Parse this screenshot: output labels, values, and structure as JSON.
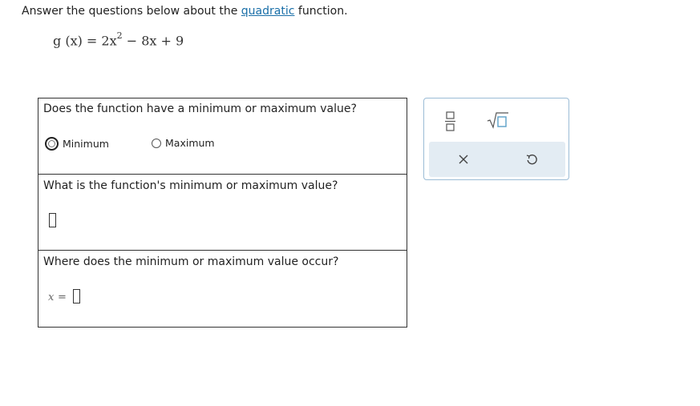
{
  "instructions": {
    "prefix": "Answer the questions below about the",
    "link_text": "quadratic",
    "suffix": "function."
  },
  "equation": {
    "lhs": "g (x) = 2x",
    "exponent": "2",
    "rhs": " − 8x + 9"
  },
  "questions": {
    "q1": {
      "text": "Does the function have a minimum or maximum value?",
      "options": [
        "Minimum",
        "Maximum"
      ]
    },
    "q2": {
      "text": "What is the function's minimum or maximum value?"
    },
    "q3": {
      "text": "Where does the minimum or maximum value occur?",
      "var_label": "x",
      "equals": "="
    }
  },
  "toolpanel": {
    "icons": [
      "fraction-icon",
      "sqrt-icon",
      "clear-icon",
      "undo-icon"
    ],
    "accent_color": "#9bbcd6",
    "bar_color": "#e3ecf3"
  },
  "colors": {
    "link": "#1a6fa8",
    "border": "#333333"
  }
}
